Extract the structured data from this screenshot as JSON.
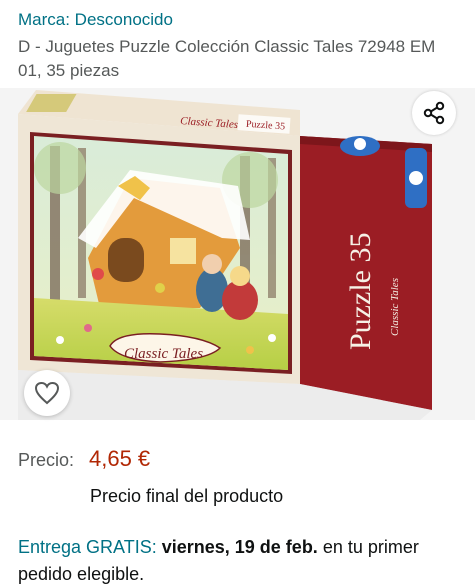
{
  "product": {
    "brand_line": "Marca: Desconocido",
    "title": "D - Juguetes Puzzle Colección Classic Tales 72948 EM 01, 35 piezas"
  },
  "image": {
    "box_text": {
      "puzzle": "Puzzle 35",
      "series": "Classic Tales"
    }
  },
  "actions": {
    "share_icon": "share-icon",
    "wishlist_icon": "heart-outline-icon"
  },
  "price": {
    "label": "Precio:",
    "value": "4,65 €",
    "note": "Precio final del producto"
  },
  "delivery": {
    "prefix": "Entrega GRATIS:",
    "date": "viernes, 19 de feb.",
    "suffix": "en tu primer pedido elegible."
  },
  "colors": {
    "link": "#007185",
    "price": "#b12704",
    "text": "#0f1111",
    "muted": "#565959",
    "box_red": "#9b1d24"
  }
}
